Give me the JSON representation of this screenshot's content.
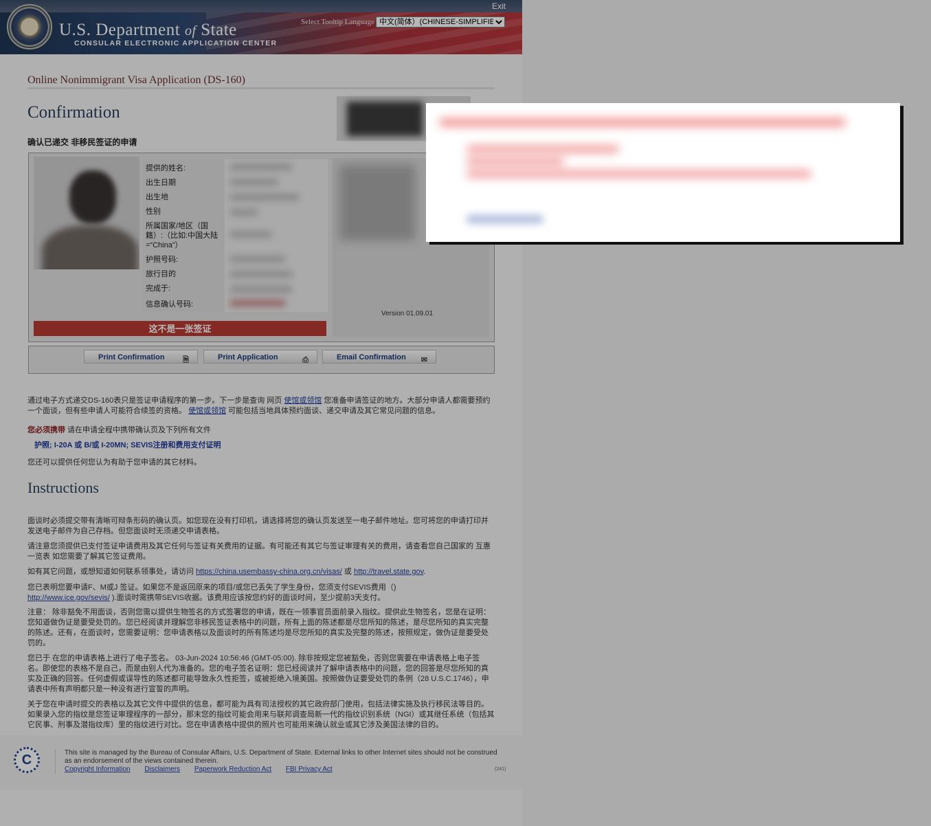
{
  "header": {
    "exit_label": "Exit",
    "dept_prefix": "U.S. Department",
    "dept_of": "of",
    "dept_suffix": "State",
    "center_label": "CONSULAR ELECTRONIC APPLICATION CENTER",
    "tooltip_label": "Select Tooltip Language",
    "tooltip_language": "中文(简体）(CHINESE-SIMPLIFIED)"
  },
  "page": {
    "app_title": "Online Nonimmigrant Visa Application (DS-160)",
    "heading": "Confirmation",
    "subheading": "确认已递交 非移民签证的申请"
  },
  "summary": {
    "labels": [
      "提供的姓名:",
      "出生日期",
      "出生地",
      "性别",
      "所属国家/地区（国籍）:（比如:中国大陆 =“China”）",
      "护照号码:",
      "旅行目的",
      "完成于:",
      "信息确认号码:"
    ],
    "version": "Version 01.09.01",
    "not_visa": "这不是一张签证"
  },
  "buttons": {
    "print_confirmation": "Print Confirmation",
    "print_application": "Print Application",
    "email_confirmation": "Email Confirmation",
    "print_conf_icon": "document-icon",
    "print_app_icon": "printer-icon",
    "email_icon": "envelope-icon"
  },
  "body": {
    "intro_a": "通过电子方式递交DS-160表只是签证申请程序的第一步。下一步是查询 网页 ",
    "intro_link1": "使馆或领馆",
    "intro_b": " 您准备申请签证的地方。大部分申请人都需要预约一个面谈，但有些申请人可能符合续签的资格。 ",
    "intro_link2": "使馆或领馆",
    "intro_c": " 可能包括当地具体预约面谈、递交申请及其它常见问题的信息。",
    "must_label": "您必须携带",
    "must_text": " 请在申请全程中携带确认页及下列所有文件",
    "docs": "护照; I-20A 或 B/或 I-20MN; SEVIS注册和费用支付证明",
    "other_docs": "您还可以提供任何您认为有助于您申请的其它材料。",
    "instructions_heading": "Instructions",
    "inst1": "面谈时必须提交带有清晰可辩条形码的确认页。如您现在没有打印机，请选择将您的确认页发送至一电子邮件地址。您可将您的申请打印并发送电子邮件为自己存档。但您面谈时无须递交申请表格。",
    "inst2": "请注意您须提供已支付签证申请费用及其它任何与签证有关费用的证据。有可能还有其它与签证审理有关的费用，请查看您自己国家的 互惠一览表 如您需要了解其它签证费用。",
    "inst3_a": "如有其它问题，或想知道如何联系领事处，请访问 ",
    "inst3_link1": "https://china.usembassy-china.org.cn/visas/",
    "inst3_b": " 或 ",
    "inst3_link2": "http://travel.state.gov",
    "inst3_c": ".",
    "inst4_a": "您已表明您要申请F、M或J 签证。如果您不是返回原来的项目/或您已丢失了学生身份，您须支付SEVIS费用（)",
    "inst4_link": "http://www.ice.gov/sevis/",
    "inst4_b": " ).面谈时需携带SEVIS收据。该费用应该按您约好的面谈时间，至少提前3天支付。",
    "inst5": "注意： 除非豁免不用面谈，否则您需以提供生物签名的方式签署您的申请，既在一领事官员面前录入指纹。提供此生物签名，您是在证明：您知道做伪证是要受处罚的。您已经阅读并理解您非移民签证表格中的问题，所有上面的陈述都是尽您所知的陈述，是尽您所知的真实完整的陈述。还有，在面谈时，您需要证明：您申请表格以及面谈时的所有陈述均是尽您所知的真实及完整的陈述，按照规定，做伪证是要受处罚的。",
    "inst6": "您已于 在您的申请表格上进行了电子签名。 03-Jun-2024 10:56:46 (GMT-05:00). 除非按规定您被豁免，否则您需要在申请表格上电子签名。即使您的表格不是自己，而是由别人代为准备的。您的电子签名证明：您已经阅读并了解申请表格中的问题，您的回答是尽您所知的真实及正确的回答。任何虚假或误导性的陈述都可能导致永久性拒签，或被拒绝入境美国。按照做伪证要受处罚的条例（28 U.S.C.1746），申请表中所有声明都只是一种没有进行宣誓的声明。",
    "inst7": "关于您在申请时提交的表格以及其它文件中提供的信息，都可能为具有司法授权的其它政府部门使用，包括法律实施及执行移民法等目的。如果录入您的指纹是您签证审理程序的一部分，那末您的指纹可能会用来与联邦调查局新一代的指纹识别系统（NGI）或其继任系统（包括其它民事、刑事及潜指纹库）里的指纹进行对比。您在申请表格中提供的照片也可能用来确认就业或其它涉及美国法律的目的。"
  },
  "footer": {
    "logo_letter": "C",
    "managed_text": "This site is managed by the Bureau of Consular Affairs, U.S. Department of State. External links to other Internet sites should not be construed as an endorsement of the views contained therein.",
    "links": [
      "Copyright Information",
      "Disclaimers",
      "Paperwork Reduction Act",
      "FBI Privacy Act"
    ],
    "code": "(241)"
  },
  "colors": {
    "heading": "#2b3f5d",
    "not_visa_banner": "#b83a32",
    "link": "#1f3b9a",
    "must_label": "#8c1f1f"
  }
}
